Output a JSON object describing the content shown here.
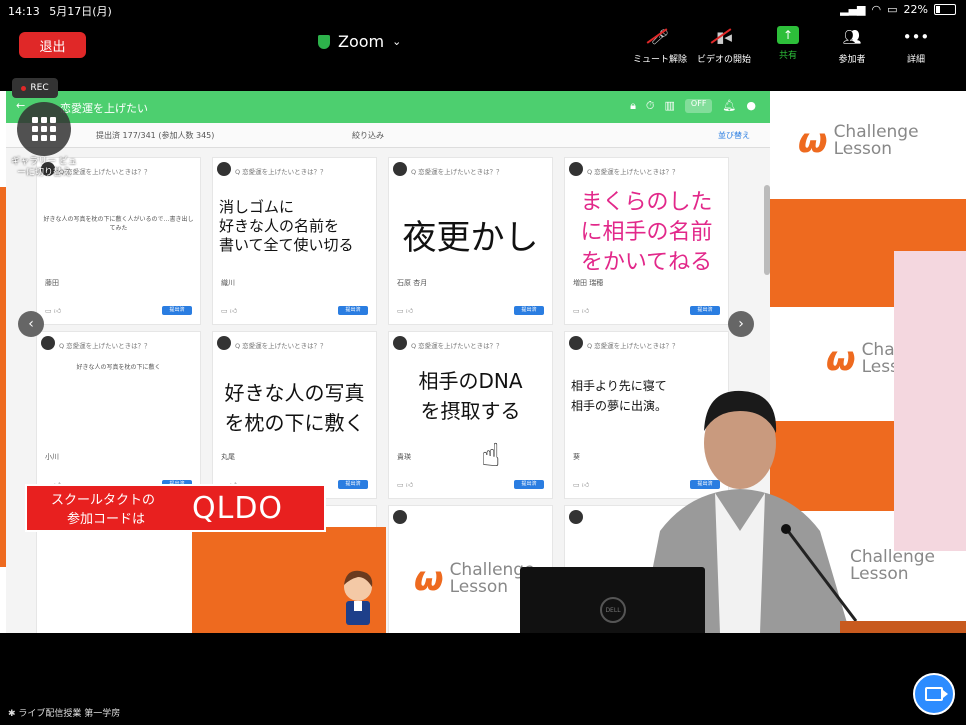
{
  "status_bar": {
    "time": "14:13",
    "date": "5月17日(月)",
    "battery": "22%"
  },
  "toolbar": {
    "leave_label": "退出",
    "meeting_title": "Zoom",
    "unmute_label": "ミュート解除",
    "start_video_label": "ビデオの開始",
    "share_label": "共有",
    "participants_label": "参加者",
    "more_label": "詳細"
  },
  "recording": {
    "label": "REC"
  },
  "gallery": {
    "label": "ギャラリー ビューに切り替え"
  },
  "app": {
    "title": "恋愛運を上げたい",
    "toggle_label": "OFF",
    "count_text": "提出済 177/341 (参加人数 345)",
    "filter_label": "絞り込み",
    "right_link": "並び替え"
  },
  "cards": [
    {
      "question": "Q 恋愛運を上げたいときは？？",
      "body": "好きな人の写真を枕の下に敷く人がいるので…書き出してみた",
      "author": "藤田",
      "submit": "提出済"
    },
    {
      "question": "Q 恋愛運を上げたいときは？？",
      "body": "消しゴムに\n好きな人の名前を\n書いて全て使い切る",
      "author": "織川",
      "submit": "提出済"
    },
    {
      "question": "Q 恋愛運を上げたいときは？？",
      "body": "夜更かし",
      "author": "石原 杏月",
      "submit": "提出済"
    },
    {
      "question": "Q 恋愛運を上げたいときは？？",
      "body": "まくらのした\nに相手の名前\nをかいてねる",
      "author": "増田 瑞穂",
      "submit": "提出済"
    },
    {
      "question": "Q 恋愛運を上げたいときは？？",
      "body": "好きな人の写真を枕の下に敷く",
      "author": "小川",
      "submit": "提出済"
    },
    {
      "question": "Q 恋愛運を上げたいときは？？",
      "body": "好きな人の写真\nを枕の下に敷く",
      "author": "丸尾",
      "submit": "提出済"
    },
    {
      "question": "Q 恋愛運を上げたいときは？？",
      "body": "相手のDNA\nを摂取する",
      "author": "貴瑛",
      "submit": "提出済"
    },
    {
      "question": "Q 恋愛運を上げたいときは？？",
      "body": "相手より先に寝て\n相手の夢に出演。",
      "author": "葵",
      "submit": "提出済"
    }
  ],
  "brand": {
    "line1": "Challenge",
    "line2": "Lesson"
  },
  "banner": {
    "line1": "スクールタクトの",
    "line2": "参加コードは",
    "code": "QLDO"
  },
  "laptop": {
    "brand": "DELL"
  },
  "footer": {
    "text": "ライブ配信授業 第一学房"
  },
  "colors": {
    "accent_green": "#4dcf6f",
    "brand_orange": "#ee6a1f",
    "leave_red": "#e02828",
    "zoom_blue": "#2d8cff",
    "banner_red": "#e8201f"
  }
}
